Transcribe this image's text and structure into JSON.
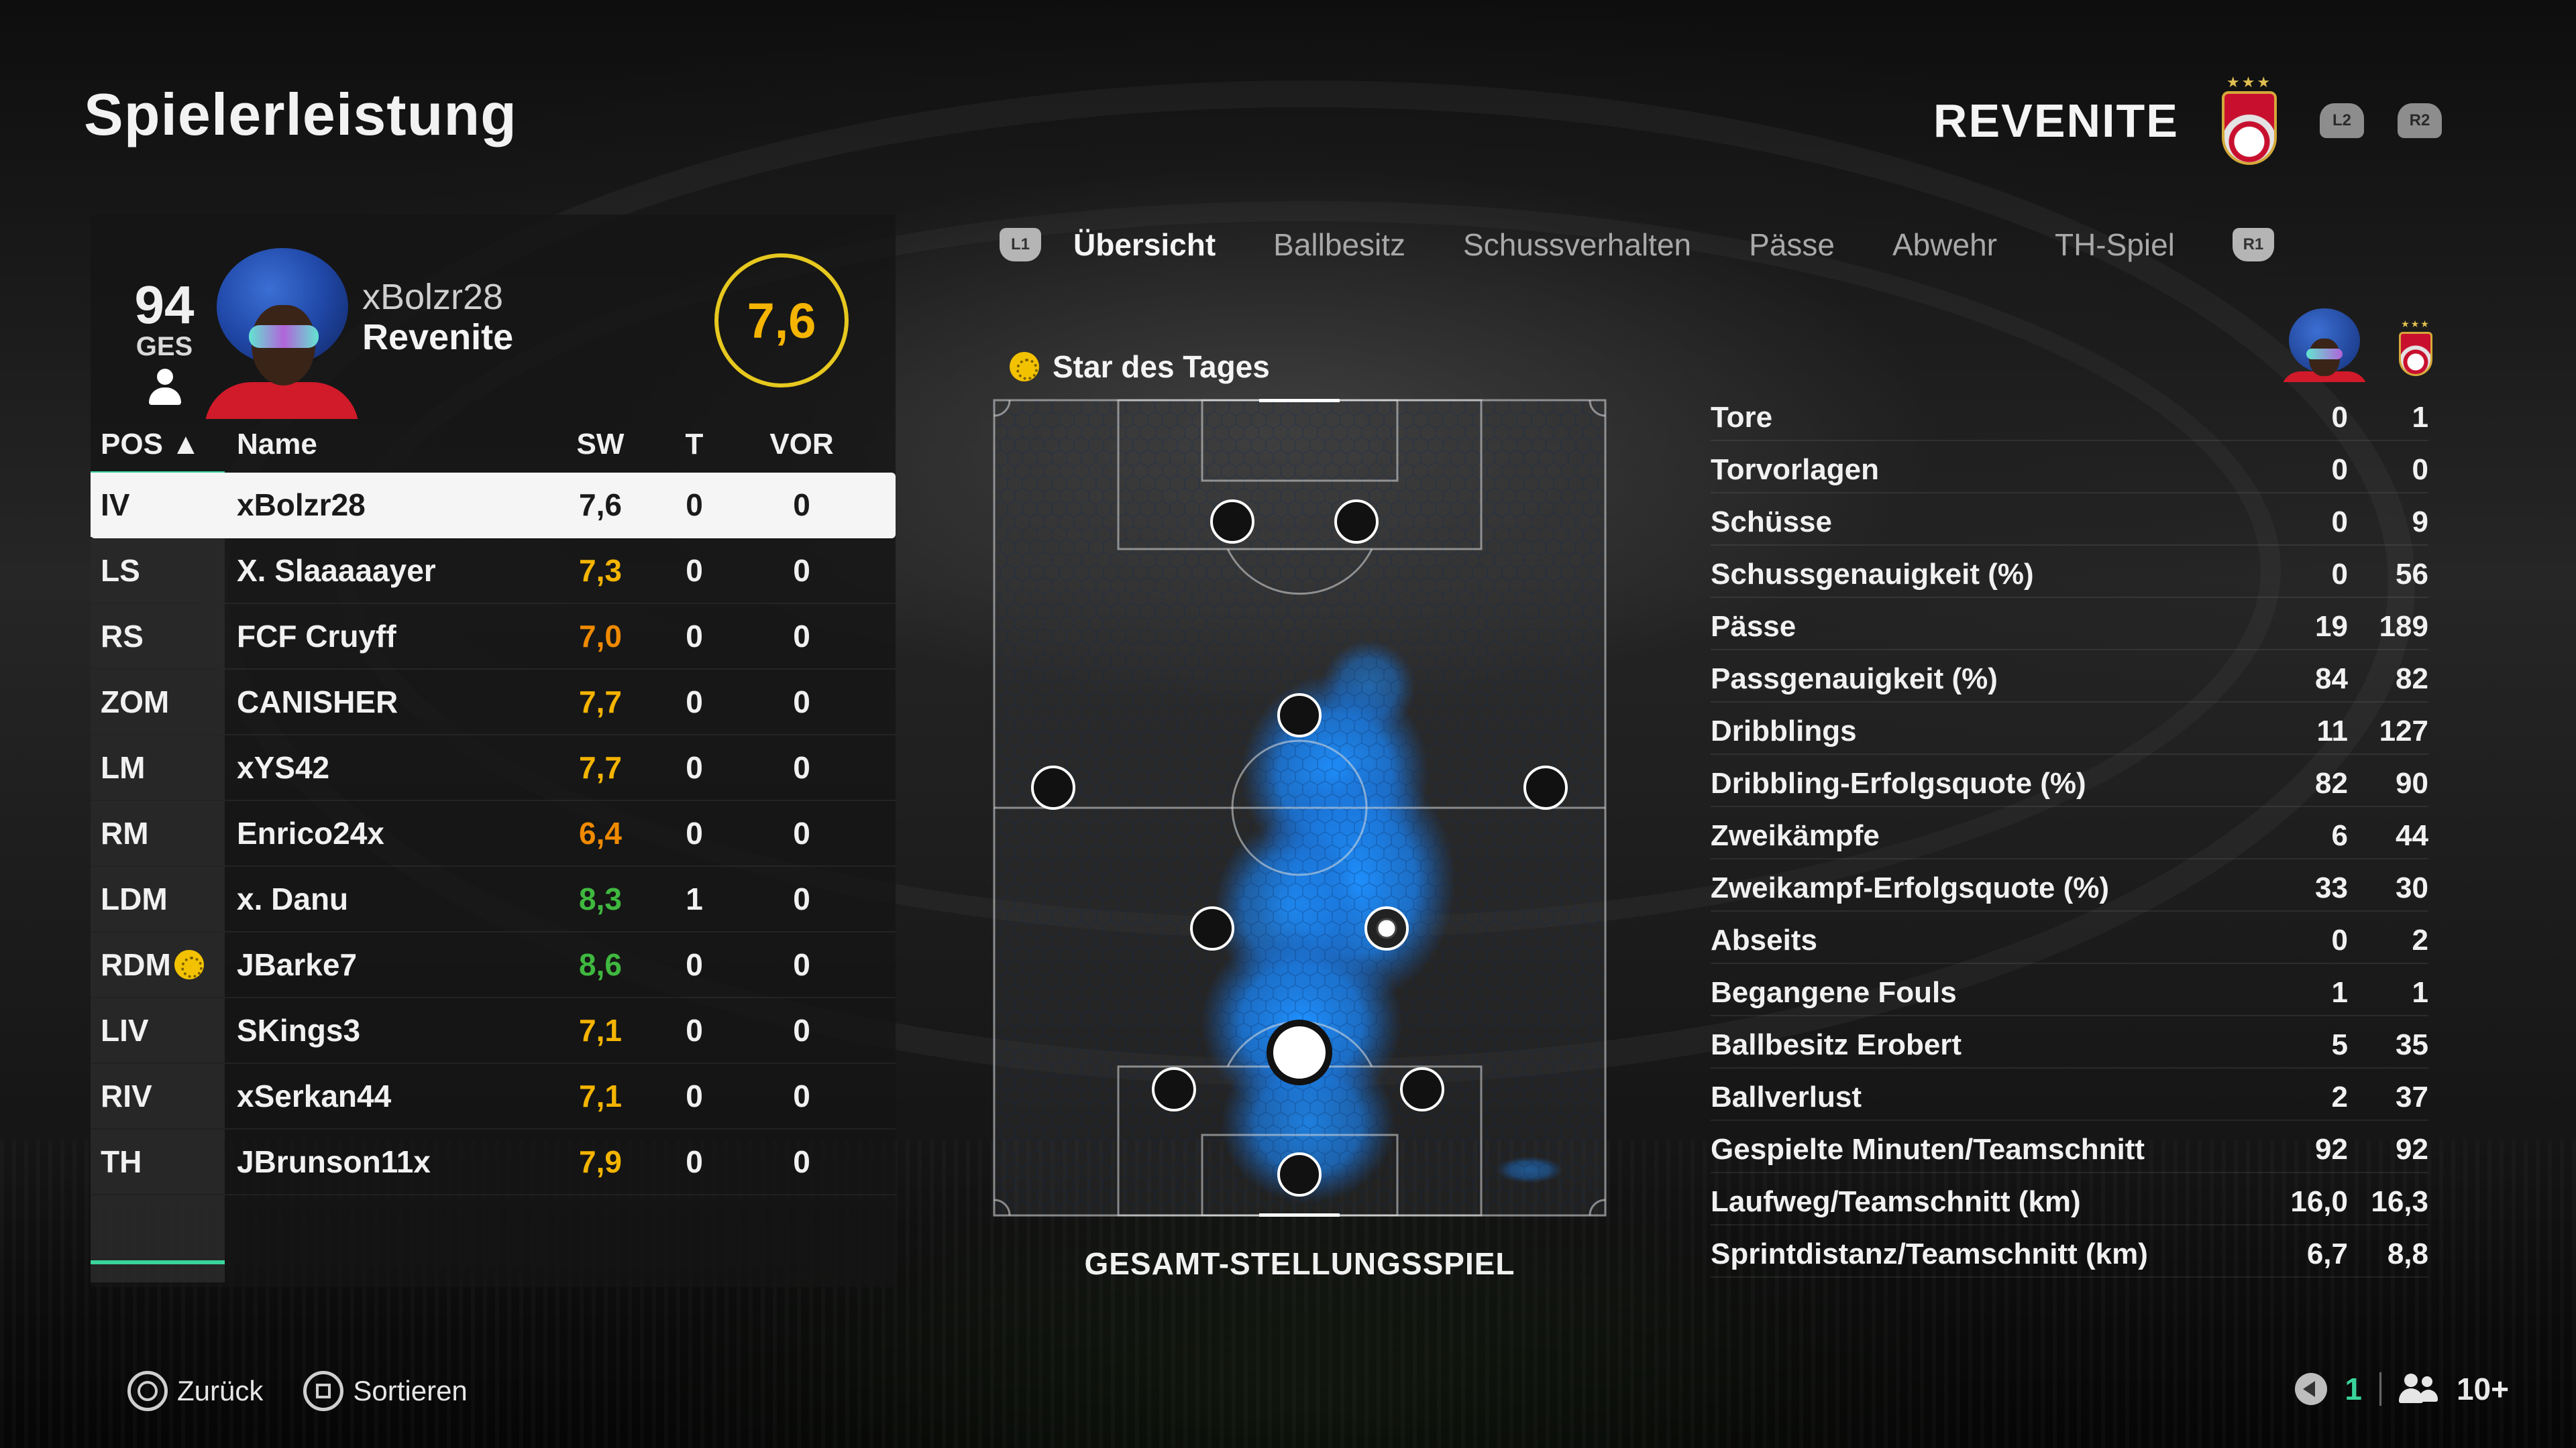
{
  "page_title": "Spielerleistung",
  "team": {
    "name": "REVENITE",
    "trigger_left": "L2",
    "trigger_right": "R2"
  },
  "player_card": {
    "overall": "94",
    "overall_label": "GES",
    "name": "xBolzr28",
    "club": "Revenite",
    "rating": "7,6",
    "rating_color": "#f4b400"
  },
  "table": {
    "headers": {
      "pos": "POS ▲",
      "name": "Name",
      "sw": "SW",
      "t": "T",
      "vor": "VOR"
    },
    "rows": [
      {
        "pos": "IV",
        "name": "xBolzr28",
        "sw": "7,6",
        "t": "0",
        "vor": "0",
        "color": "#1a1a1a",
        "selected": true
      },
      {
        "pos": "LS",
        "name": "X. Slaaaaayer",
        "sw": "7,3",
        "t": "0",
        "vor": "0",
        "color": "#f4b400"
      },
      {
        "pos": "RS",
        "name": "FCF Cruyff",
        "sw": "7,0",
        "t": "0",
        "vor": "0",
        "color": "#f08a00"
      },
      {
        "pos": "ZOM",
        "name": "CANISHER",
        "sw": "7,7",
        "t": "0",
        "vor": "0",
        "color": "#f4b400"
      },
      {
        "pos": "LM",
        "name": "xYS42",
        "sw": "7,7",
        "t": "0",
        "vor": "0",
        "color": "#f4b400"
      },
      {
        "pos": "RM",
        "name": "Enrico24x",
        "sw": "6,4",
        "t": "0",
        "vor": "0",
        "color": "#f08a00"
      },
      {
        "pos": "LDM",
        "name": "x. Danu",
        "sw": "8,3",
        "t": "1",
        "vor": "0",
        "color": "#3fb83f"
      },
      {
        "pos": "RDM",
        "name": "JBarke7",
        "sw": "8,6",
        "t": "0",
        "vor": "0",
        "color": "#3fb83f",
        "star": true
      },
      {
        "pos": "LIV",
        "name": "SKings3",
        "sw": "7,1",
        "t": "0",
        "vor": "0",
        "color": "#f4b400"
      },
      {
        "pos": "RIV",
        "name": "xSerkan44",
        "sw": "7,1",
        "t": "0",
        "vor": "0",
        "color": "#f4b400"
      },
      {
        "pos": "TH",
        "name": "JBrunson11x",
        "sw": "7,9",
        "t": "0",
        "vor": "0",
        "color": "#f4b400"
      }
    ]
  },
  "tabs": {
    "left_button": "L1",
    "right_button": "R1",
    "items": [
      "Übersicht",
      "Ballbesitz",
      "Schussverhalten",
      "Pässe",
      "Abwehr",
      "TH-Spiel"
    ],
    "active_index": 0
  },
  "star_of_day": "Star des Tages",
  "pitch_caption": "GESAMT-STELLUNGSSPIEL",
  "stats": [
    {
      "label": "Tore",
      "player": "0",
      "team": "1"
    },
    {
      "label": "Torvorlagen",
      "player": "0",
      "team": "0"
    },
    {
      "label": "Schüsse",
      "player": "0",
      "team": "9"
    },
    {
      "label": "Schussgenauigkeit (%)",
      "player": "0",
      "team": "56"
    },
    {
      "label": "Pässe",
      "player": "19",
      "team": "189"
    },
    {
      "label": "Passgenauigkeit (%)",
      "player": "84",
      "team": "82"
    },
    {
      "label": "Dribblings",
      "player": "11",
      "team": "127"
    },
    {
      "label": "Dribbling-Erfolgsquote (%)",
      "player": "82",
      "team": "90"
    },
    {
      "label": "Zweikämpfe",
      "player": "6",
      "team": "44"
    },
    {
      "label": "Zweikampf-Erfolgsquote (%)",
      "player": "33",
      "team": "30"
    },
    {
      "label": "Abseits",
      "player": "0",
      "team": "2"
    },
    {
      "label": "Begangene Fouls",
      "player": "1",
      "team": "1"
    },
    {
      "label": "Ballbesitz Erobert",
      "player": "5",
      "team": "35"
    },
    {
      "label": "Ballverlust",
      "player": "2",
      "team": "37"
    },
    {
      "label": "Gespielte Minuten/Teamschnitt",
      "player": "92",
      "team": "92"
    },
    {
      "label": "Laufweg/Teamschnitt (km)",
      "player": "16,0",
      "team": "16,3"
    },
    {
      "label": "Sprintdistanz/Teamschnitt (km)",
      "player": "6,7",
      "team": "8,8"
    }
  ],
  "footer": {
    "back_label": "Zurück",
    "sort_label": "Sortieren",
    "voice_count": "1",
    "party_count": "10+"
  },
  "colors": {
    "accent": "#3ad39b",
    "heatmap": "#1e90ff",
    "rating_ring": "#e6c81f"
  }
}
